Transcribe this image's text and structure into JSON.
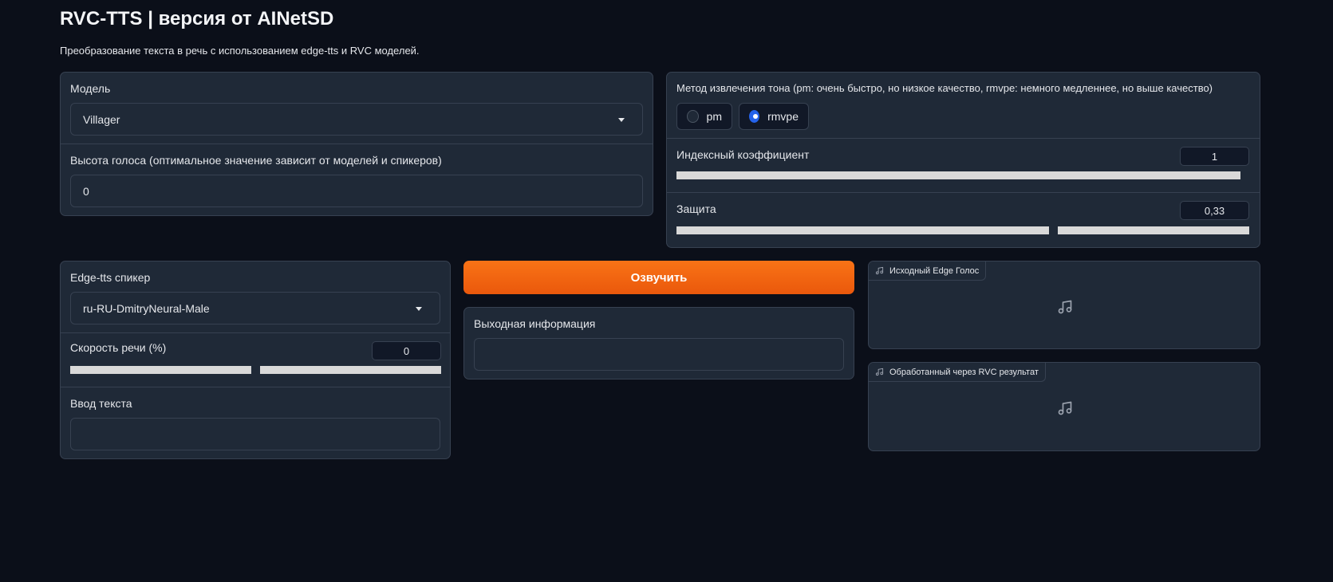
{
  "header": {
    "title": "RVC-TTS | версия от AINetSD",
    "subtitle": "Преобразование текста в речь с использованием edge-tts и RVC моделей."
  },
  "model": {
    "label": "Модель",
    "value": "Villager"
  },
  "pitch": {
    "label": "Высота голоса (оптимальное значение зависит от моделей и спикеров)",
    "value": "0"
  },
  "f0_method": {
    "label": "Метод извлечения тона (pm: очень быстро, но низкое качество, rmvpe: немного медленнее, но выше качество)",
    "options": [
      {
        "label": "pm",
        "selected": false
      },
      {
        "label": "rmvpe",
        "selected": true
      }
    ]
  },
  "index_rate": {
    "label": "Индексный коэффициент",
    "value": "1",
    "fraction": 1.0
  },
  "protect": {
    "label": "Защита",
    "value": "0,33",
    "fraction": 0.66
  },
  "speaker": {
    "label": "Edge-tts спикер",
    "value": "ru-RU-DmitryNeural-Male"
  },
  "speed": {
    "label": "Скорость речи (%)",
    "value": "0",
    "fraction": 0.5
  },
  "text_input": {
    "label": "Ввод текста",
    "value": ""
  },
  "convert_button": {
    "label": "Озвучить"
  },
  "output_info": {
    "label": "Выходная информация",
    "value": ""
  },
  "audio_edge": {
    "label": "Исходный Edge Голос",
    "icon": "music-note-icon"
  },
  "audio_rvc": {
    "label": "Обработанный через RVC результат",
    "icon": "music-note-icon"
  },
  "colors": {
    "background": "#0b0f19",
    "panel": "#1f2937",
    "border": "#374151",
    "accent": "#f97316",
    "radio_selected": "#2563eb"
  }
}
